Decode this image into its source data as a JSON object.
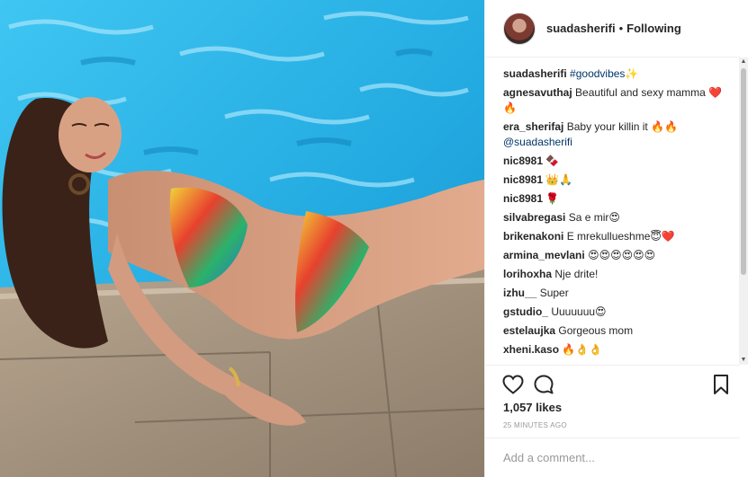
{
  "post": {
    "username": "suadasherifi",
    "separator": "•",
    "follow_status": "Following"
  },
  "caption": {
    "username": "suadasherifi",
    "text": "#goodvibes✨"
  },
  "comments": [
    {
      "user": "agnesavuthaj",
      "text": "Beautiful and sexy mamma ❤️🔥"
    },
    {
      "user": "era_sherifaj",
      "text": "Baby your killin it 🔥🔥",
      "mention": "@suadasherifi"
    },
    {
      "user": "nic8981",
      "text": "🍫"
    },
    {
      "user": "nic8981",
      "text": "👑🙏"
    },
    {
      "user": "nic8981",
      "text": "🌹"
    },
    {
      "user": "silvabregasi",
      "text": "Sa e mir😍"
    },
    {
      "user": "brikenakoni",
      "text": "E mrekullueshme😇❤️"
    },
    {
      "user": "armina_mevlani",
      "text": "😍😍😍😍😍😍"
    },
    {
      "user": "lorihoxha",
      "text": "Nje drite!"
    },
    {
      "user": "izhu__",
      "text": "Super"
    },
    {
      "user": "gstudio_",
      "text": "Uuuuuuu😍"
    },
    {
      "user": "estelaujka",
      "text": "Gorgeous mom"
    },
    {
      "user": "xheni.kaso",
      "text": "🔥👌👌"
    }
  ],
  "likes": "1,057 likes",
  "timestamp": "25 MINUTES AGO",
  "add_comment_placeholder": "Add a comment...",
  "icons": {
    "like": "heart-icon",
    "comment": "comment-bubble-icon",
    "save": "bookmark-icon",
    "scroll_up": "▲",
    "scroll_down": "▼"
  },
  "colors": {
    "text": "#262626",
    "muted": "#999999",
    "mention": "#003569",
    "border": "#efefef"
  }
}
